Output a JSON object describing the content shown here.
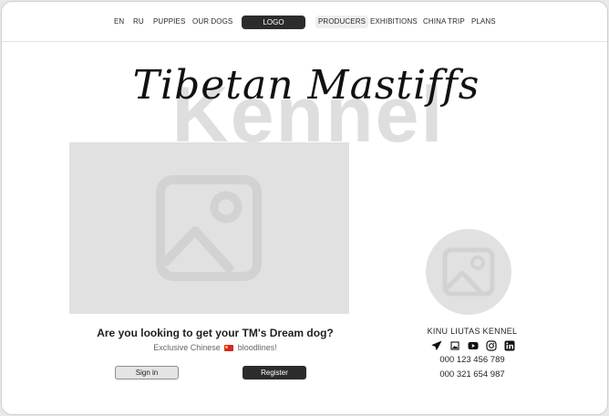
{
  "nav": {
    "lang_en": "EN",
    "lang_ru": "RU",
    "puppies": "PUPPIES",
    "our_dogs": "OUR DOGS",
    "logo": "LOGO",
    "producers": "PRODUCERS",
    "exhibitions": "EXHIBITIONS",
    "china_trip": "CHINA TRIP",
    "plans": "PLANS"
  },
  "hero": {
    "title": "Tibetan Mastiffs",
    "background_word": "Kennel"
  },
  "cta": {
    "heading": "Are you looking to get your TM's Dream dog?",
    "sub_before": "Exclusive Chinese",
    "sub_after": "bloodlines!",
    "flag_icon": "china-flag-icon",
    "signin_label": "Sign in",
    "register_label": "Register"
  },
  "kennel": {
    "name": "KINU LIUTAS KENNEL",
    "social_icons": [
      "telegram-icon",
      "image-icon",
      "youtube-icon",
      "instagram-icon",
      "linkedin-icon"
    ],
    "phone_1": "000 123 456 789",
    "phone_2": "000 321 654 987"
  },
  "colors": {
    "dark_button": "#2c2c2c",
    "placeholder_gray": "#e1e1e1",
    "background_word": "#dedede"
  }
}
